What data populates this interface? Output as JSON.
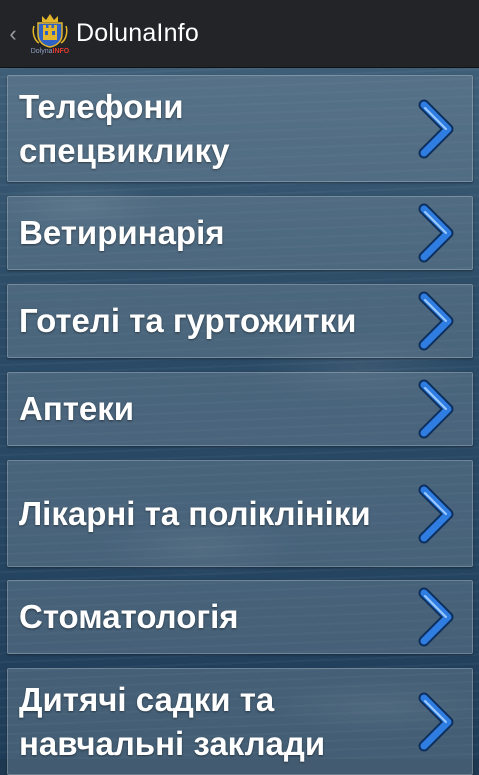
{
  "app": {
    "title": "DolunaInfo",
    "logo_text_a": "Dolyna",
    "logo_text_b": "INFO"
  },
  "colors": {
    "actionbar": "#222428",
    "chevron_blue": "#2f7de0",
    "item_text": "#ffffff"
  },
  "menu": [
    {
      "label": "Телефони спецвиклику",
      "icon": "chevron-right-icon"
    },
    {
      "label": "Ветиринарія",
      "icon": "chevron-right-icon"
    },
    {
      "label": "Готелі та гуртожитки",
      "icon": "chevron-right-icon"
    },
    {
      "label": "Аптеки",
      "icon": "chevron-right-icon"
    },
    {
      "label": "Лікарні та поліклініки",
      "icon": "chevron-right-icon"
    },
    {
      "label": "Стоматологія",
      "icon": "chevron-right-icon"
    },
    {
      "label": "Дитячі садки та навчальні заклади",
      "icon": "chevron-right-icon"
    }
  ]
}
